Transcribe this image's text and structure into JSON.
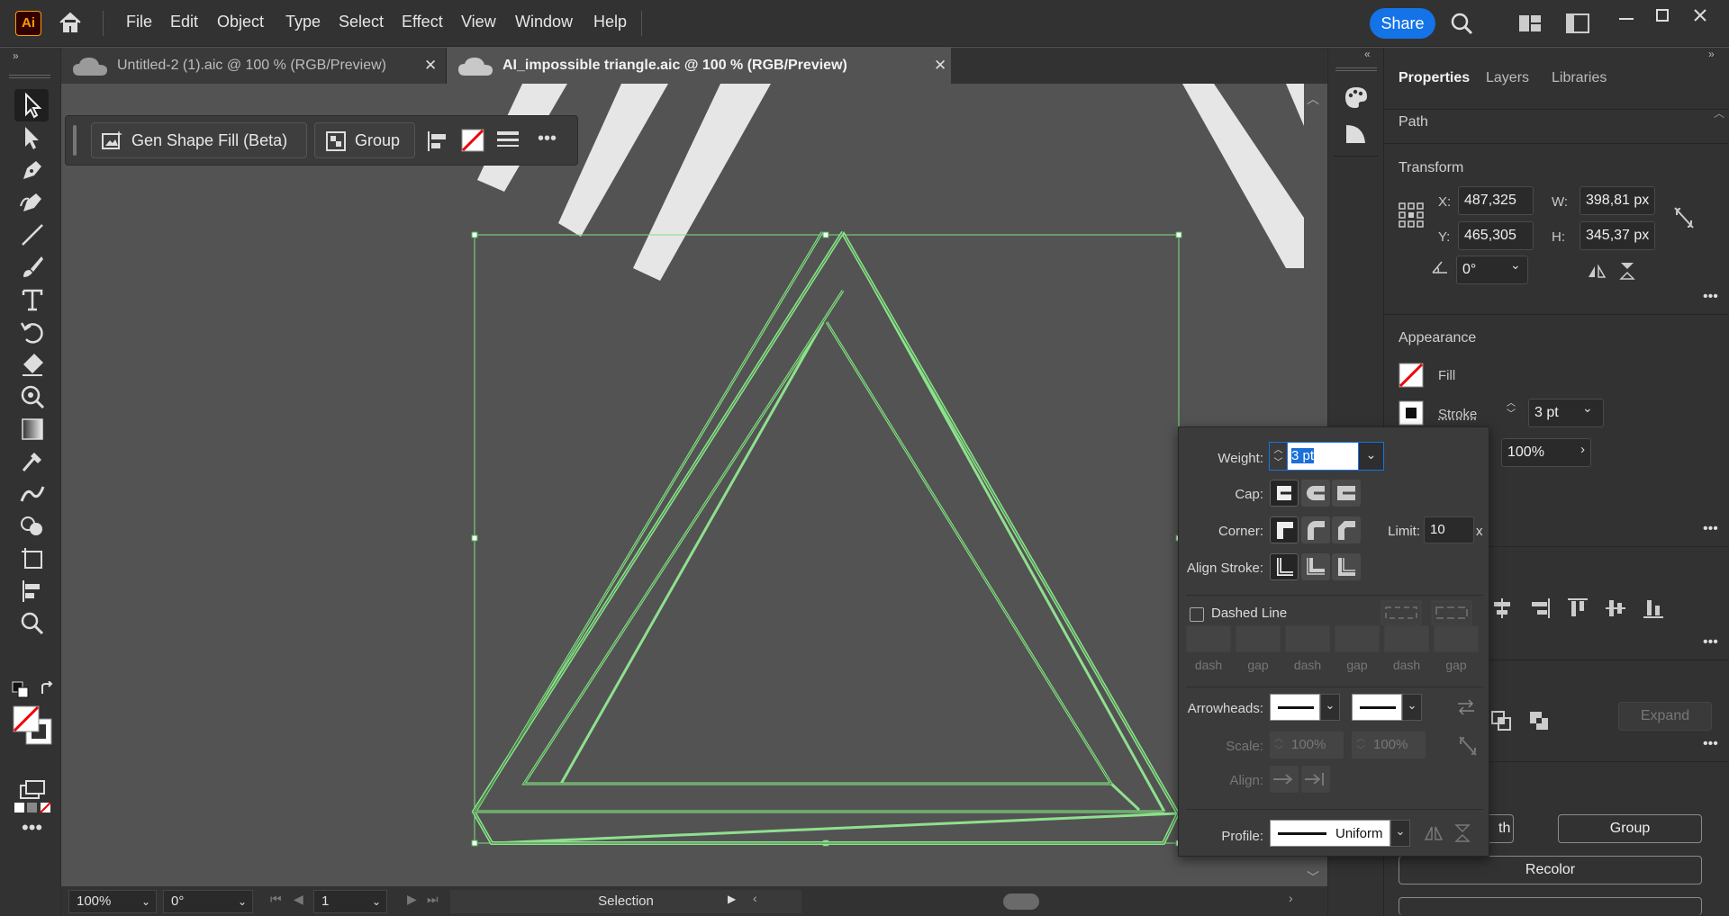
{
  "app": {
    "logo_text": "Ai",
    "accent": "#1473e6"
  },
  "menu": [
    "File",
    "Edit",
    "Object",
    "Type",
    "Select",
    "Effect",
    "View",
    "Window",
    "Help"
  ],
  "share_label": "Share",
  "tabs": [
    {
      "label": "Untitled-2 (1).aic @ 100 % (RGB/Preview)",
      "active": false
    },
    {
      "label": "AI_impossible triangle.aic @ 100 % (RGB/Preview)",
      "active": true
    }
  ],
  "context_bar": {
    "gen_shape_fill": "Gen Shape Fill (Beta)",
    "group": "Group"
  },
  "status": {
    "zoom": "100%",
    "rotation": "0°",
    "artboard": "1",
    "tool": "Selection"
  },
  "properties": {
    "tabs": [
      "Properties",
      "Layers",
      "Libraries"
    ],
    "object_type": "Path",
    "transform": {
      "title": "Transform",
      "x_label": "X:",
      "x": "487,325 px",
      "y_label": "Y:",
      "y": "465,305 px",
      "w_label": "W:",
      "w": "398,81 px",
      "h_label": "H:",
      "h": "345,37 px",
      "angle": "0°"
    },
    "appearance": {
      "title": "Appearance",
      "fill_label": "Fill",
      "stroke_label": "Stroke",
      "stroke_weight": "3 pt",
      "opacity": "100%"
    },
    "quick_actions": {
      "expand": "Expand",
      "path_partial": "th",
      "group": "Group",
      "recolor": "Recolor"
    }
  },
  "stroke_popup": {
    "weight_label": "Weight:",
    "weight": "3 pt",
    "cap_label": "Cap:",
    "corner_label": "Corner:",
    "limit_label": "Limit:",
    "limit": "10",
    "limit_unit": "x",
    "align_label": "Align Stroke:",
    "dashed_label": "Dashed Line",
    "dash_labels": [
      "dash",
      "gap",
      "dash",
      "gap",
      "dash",
      "gap"
    ],
    "arrowheads_label": "Arrowheads:",
    "scale_label": "Scale:",
    "scale1": "100%",
    "scale2": "100%",
    "align2_label": "Align:",
    "profile_label": "Profile:",
    "profile": "Uniform"
  }
}
